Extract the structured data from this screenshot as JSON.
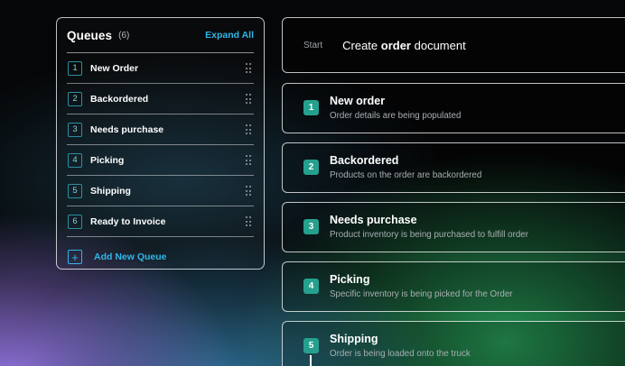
{
  "queues": {
    "title": "Queues",
    "count": "(6)",
    "expand_label": "Expand All",
    "items": [
      {
        "num": "1",
        "label": "New Order"
      },
      {
        "num": "2",
        "label": "Backordered"
      },
      {
        "num": "3",
        "label": "Needs purchase"
      },
      {
        "num": "4",
        "label": "Picking"
      },
      {
        "num": "5",
        "label": "Shipping"
      },
      {
        "num": "6",
        "label": "Ready to Invoice"
      }
    ],
    "add_icon": "+",
    "add_label": "Add New Queue"
  },
  "workflow": {
    "start_label": "Start",
    "start_pre": "Create ",
    "start_bold": "order",
    "start_post": " document",
    "steps": [
      {
        "num": "1",
        "title": "New order",
        "desc": "Order details are being populated"
      },
      {
        "num": "2",
        "title": "Backordered",
        "desc": "Products on the order are backordered"
      },
      {
        "num": "3",
        "title": "Needs purchase",
        "desc": "Product inventory is being purchased to fulfill order"
      },
      {
        "num": "4",
        "title": "Picking",
        "desc": "Specific inventory is being picked for the Order"
      },
      {
        "num": "5",
        "title": "Shipping",
        "desc": "Order is being loaded onto the truck"
      }
    ]
  },
  "colors": {
    "accent": "#2fb6e8",
    "step_badge": "#26a08e"
  }
}
